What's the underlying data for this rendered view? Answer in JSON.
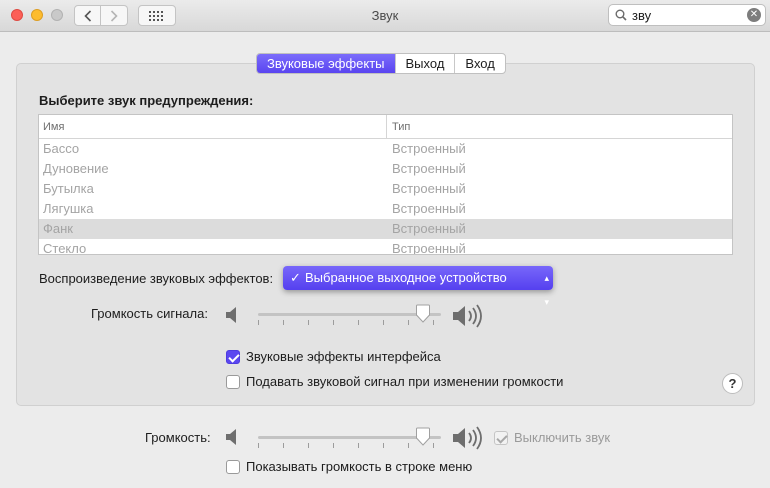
{
  "window": {
    "title": "Звук",
    "search_value": "зву"
  },
  "tabs": [
    {
      "label": "Звуковые эффекты",
      "active": true
    },
    {
      "label": "Выход",
      "active": false
    },
    {
      "label": "Вход",
      "active": false
    }
  ],
  "alert": {
    "section_label": "Выберите звук предупреждения:",
    "columns": [
      "Имя",
      "Тип"
    ],
    "rows": [
      {
        "name": "Бассо",
        "type": "Встроенный"
      },
      {
        "name": "Дуновение",
        "type": "Встроенный"
      },
      {
        "name": "Бутылка",
        "type": "Встроенный"
      },
      {
        "name": "Лягушка",
        "type": "Встроенный"
      },
      {
        "name": "Фанк",
        "type": "Встроенный",
        "selected": true
      },
      {
        "name": "Стекло",
        "type": "Встроенный"
      }
    ]
  },
  "playback": {
    "label": "Воспроизведение звуковых эффектов:",
    "selected_option": "Выбранное выходное устройство"
  },
  "alert_volume": {
    "label": "Громкость сигнала:",
    "level": 0.9
  },
  "options": {
    "ui_effects": {
      "label": "Звуковые эффекты интерфейса",
      "checked": true
    },
    "volume_feedback": {
      "label": "Подавать звуковой сигнал при изменении громкости",
      "checked": false
    }
  },
  "help_label": "?",
  "output_volume": {
    "label": "Громкость:",
    "level": 0.9,
    "mute_label": "Выключить звук",
    "mute_checked": true
  },
  "menu_bar_option": {
    "label": "Показывать громкость в строке меню",
    "checked": false
  },
  "colors": {
    "accent": "#5a45f0"
  }
}
